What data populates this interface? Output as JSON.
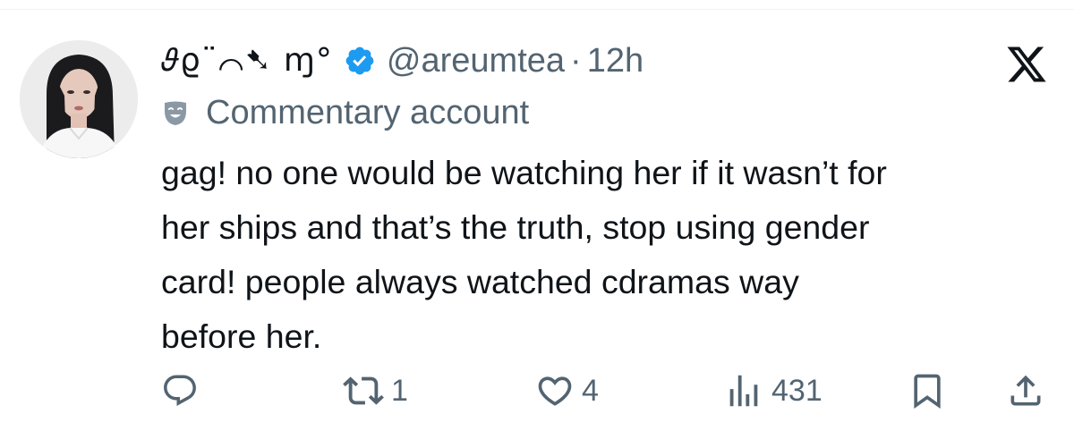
{
  "tweet": {
    "author": {
      "display_name": "𝜗ϱ¨⌒➷ ɱ°",
      "handle": "@areumtea",
      "verified_icon": "verified-badge-icon",
      "avatar": "profile-photo"
    },
    "separator": "·",
    "time": "12h",
    "platform_icon": "x-logo-icon",
    "account_label": {
      "icon": "theater-mask-icon",
      "text": "Commentary account"
    },
    "text_lines": [
      "gag! no one would be watching her if it wasn’t for",
      "her ships and that’s the truth, stop using gender",
      "card! people always watched cdramas way",
      "before her."
    ],
    "actions": {
      "reply": {
        "icon": "reply-icon",
        "count": ""
      },
      "retweet": {
        "icon": "retweet-icon",
        "count": "1"
      },
      "like": {
        "icon": "heart-icon",
        "count": "4"
      },
      "views": {
        "icon": "views-chart-icon",
        "count": "431"
      },
      "bookmark": {
        "icon": "bookmark-icon"
      },
      "share": {
        "icon": "share-icon"
      }
    },
    "colors": {
      "text": "#0f1419",
      "secondary": "#536471",
      "verified": "#1d9bf0"
    }
  }
}
